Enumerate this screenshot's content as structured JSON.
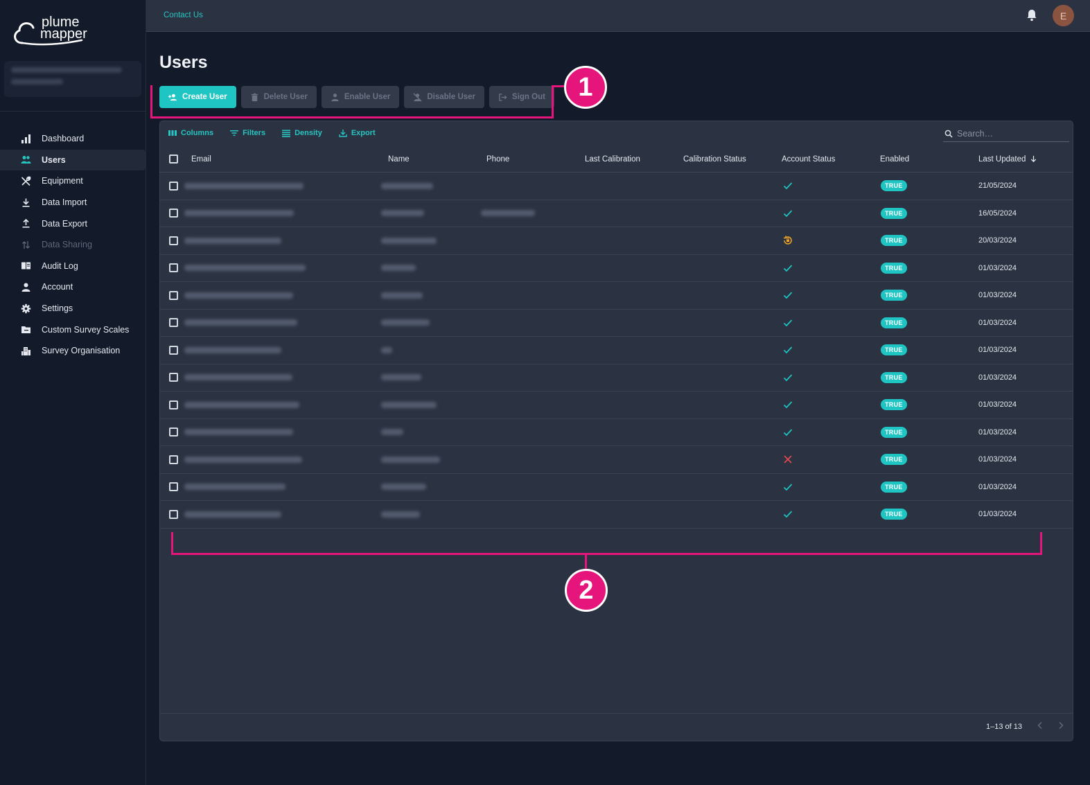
{
  "brand": {
    "logo_text_top": "plume",
    "logo_text_bottom": "mapper"
  },
  "topbar": {
    "contact_label": "Contact Us",
    "avatar_initial": "E"
  },
  "sidebar": {
    "items": [
      {
        "label": "Dashboard",
        "icon": "bar-chart-icon",
        "active": false,
        "disabled": false
      },
      {
        "label": "Users",
        "icon": "users-icon",
        "active": true,
        "disabled": false
      },
      {
        "label": "Equipment",
        "icon": "tools-icon",
        "active": false,
        "disabled": false
      },
      {
        "label": "Data Import",
        "icon": "download-icon",
        "active": false,
        "disabled": false
      },
      {
        "label": "Data Export",
        "icon": "upload-icon",
        "active": false,
        "disabled": false
      },
      {
        "label": "Data Sharing",
        "icon": "swap-icon",
        "active": false,
        "disabled": true
      },
      {
        "label": "Audit Log",
        "icon": "book-icon",
        "active": false,
        "disabled": false
      },
      {
        "label": "Account",
        "icon": "person-icon",
        "active": false,
        "disabled": false
      },
      {
        "label": "Settings",
        "icon": "gear-icon",
        "active": false,
        "disabled": false
      },
      {
        "label": "Custom Survey Scales",
        "icon": "folder-icon",
        "active": false,
        "disabled": false
      },
      {
        "label": "Survey Organisation",
        "icon": "organisation-icon",
        "active": false,
        "disabled": false
      }
    ]
  },
  "page": {
    "title": "Users"
  },
  "actions": {
    "create": "Create User",
    "delete": "Delete User",
    "enable": "Enable User",
    "disable": "Disable User",
    "signout": "Sign Out"
  },
  "callouts": {
    "one": "1",
    "two": "2"
  },
  "grid_toolbar": {
    "columns": "Columns",
    "filters": "Filters",
    "density": "Density",
    "export": "Export",
    "search_placeholder": "Search…"
  },
  "columns": {
    "email": "Email",
    "name": "Name",
    "phone": "Phone",
    "last_calibration": "Last Calibration",
    "calibration_status": "Calibration Status",
    "account_status": "Account Status",
    "enabled": "Enabled",
    "last_updated": "Last Updated"
  },
  "rows": [
    {
      "status": "check",
      "enabled": "TRUE",
      "last_updated": "21/05/2024",
      "has_phone": false
    },
    {
      "status": "check",
      "enabled": "TRUE",
      "last_updated": "16/05/2024",
      "has_phone": true
    },
    {
      "status": "reset",
      "enabled": "TRUE",
      "last_updated": "20/03/2024",
      "has_phone": false
    },
    {
      "status": "check",
      "enabled": "TRUE",
      "last_updated": "01/03/2024",
      "has_phone": false
    },
    {
      "status": "check",
      "enabled": "TRUE",
      "last_updated": "01/03/2024",
      "has_phone": false
    },
    {
      "status": "check",
      "enabled": "TRUE",
      "last_updated": "01/03/2024",
      "has_phone": false
    },
    {
      "status": "check",
      "enabled": "TRUE",
      "last_updated": "01/03/2024",
      "has_phone": false
    },
    {
      "status": "check",
      "enabled": "TRUE",
      "last_updated": "01/03/2024",
      "has_phone": false
    },
    {
      "status": "check",
      "enabled": "TRUE",
      "last_updated": "01/03/2024",
      "has_phone": false
    },
    {
      "status": "check",
      "enabled": "TRUE",
      "last_updated": "01/03/2024",
      "has_phone": false
    },
    {
      "status": "cross",
      "enabled": "TRUE",
      "last_updated": "01/03/2024",
      "has_phone": false
    },
    {
      "status": "check",
      "enabled": "TRUE",
      "last_updated": "01/03/2024",
      "has_phone": false
    },
    {
      "status": "check",
      "enabled": "TRUE",
      "last_updated": "01/03/2024",
      "has_phone": false
    }
  ],
  "pagination": {
    "text": "1–13 of 13"
  },
  "colors": {
    "accent": "#1fc5c3",
    "callout": "#e6157c",
    "error": "#e5484d",
    "warning": "#f5a623"
  }
}
